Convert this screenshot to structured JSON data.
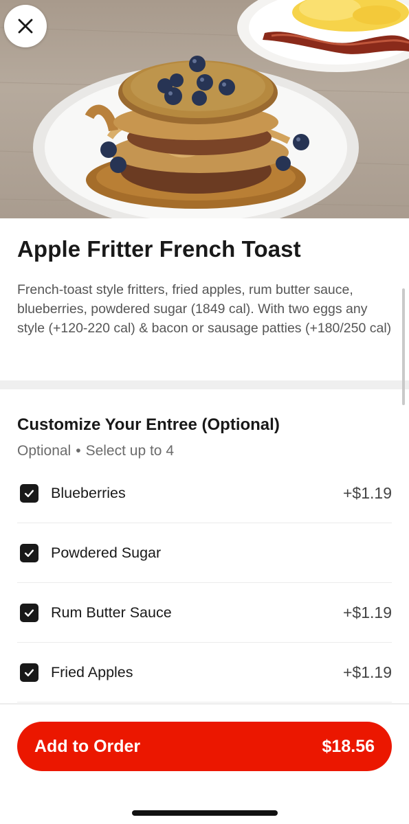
{
  "item": {
    "title": "Apple Fritter French Toast",
    "description": "French-toast style fritters, fried apples, rum butter sauce, blueberries, powdered sugar (1849 cal). With two eggs any style (+120-220 cal) & bacon or sausage patties (+180/250 cal)"
  },
  "customize": {
    "title": "Customize Your Entree (Optional)",
    "optional_label": "Optional",
    "separator": "•",
    "limit_label": "Select up to 4",
    "options": [
      {
        "label": "Blueberries",
        "price": "+$1.19",
        "checked": true
      },
      {
        "label": "Powdered Sugar",
        "price": "",
        "checked": true
      },
      {
        "label": "Rum Butter Sauce",
        "price": "+$1.19",
        "checked": true
      },
      {
        "label": "Fried Apples",
        "price": "+$1.19",
        "checked": true
      }
    ]
  },
  "footer": {
    "add_label": "Add to Order",
    "total": "$18.56"
  },
  "icons": {
    "close": "close-icon",
    "check": "checkmark-icon"
  },
  "colors": {
    "accent": "#eb1700",
    "checkbox": "#191919"
  }
}
